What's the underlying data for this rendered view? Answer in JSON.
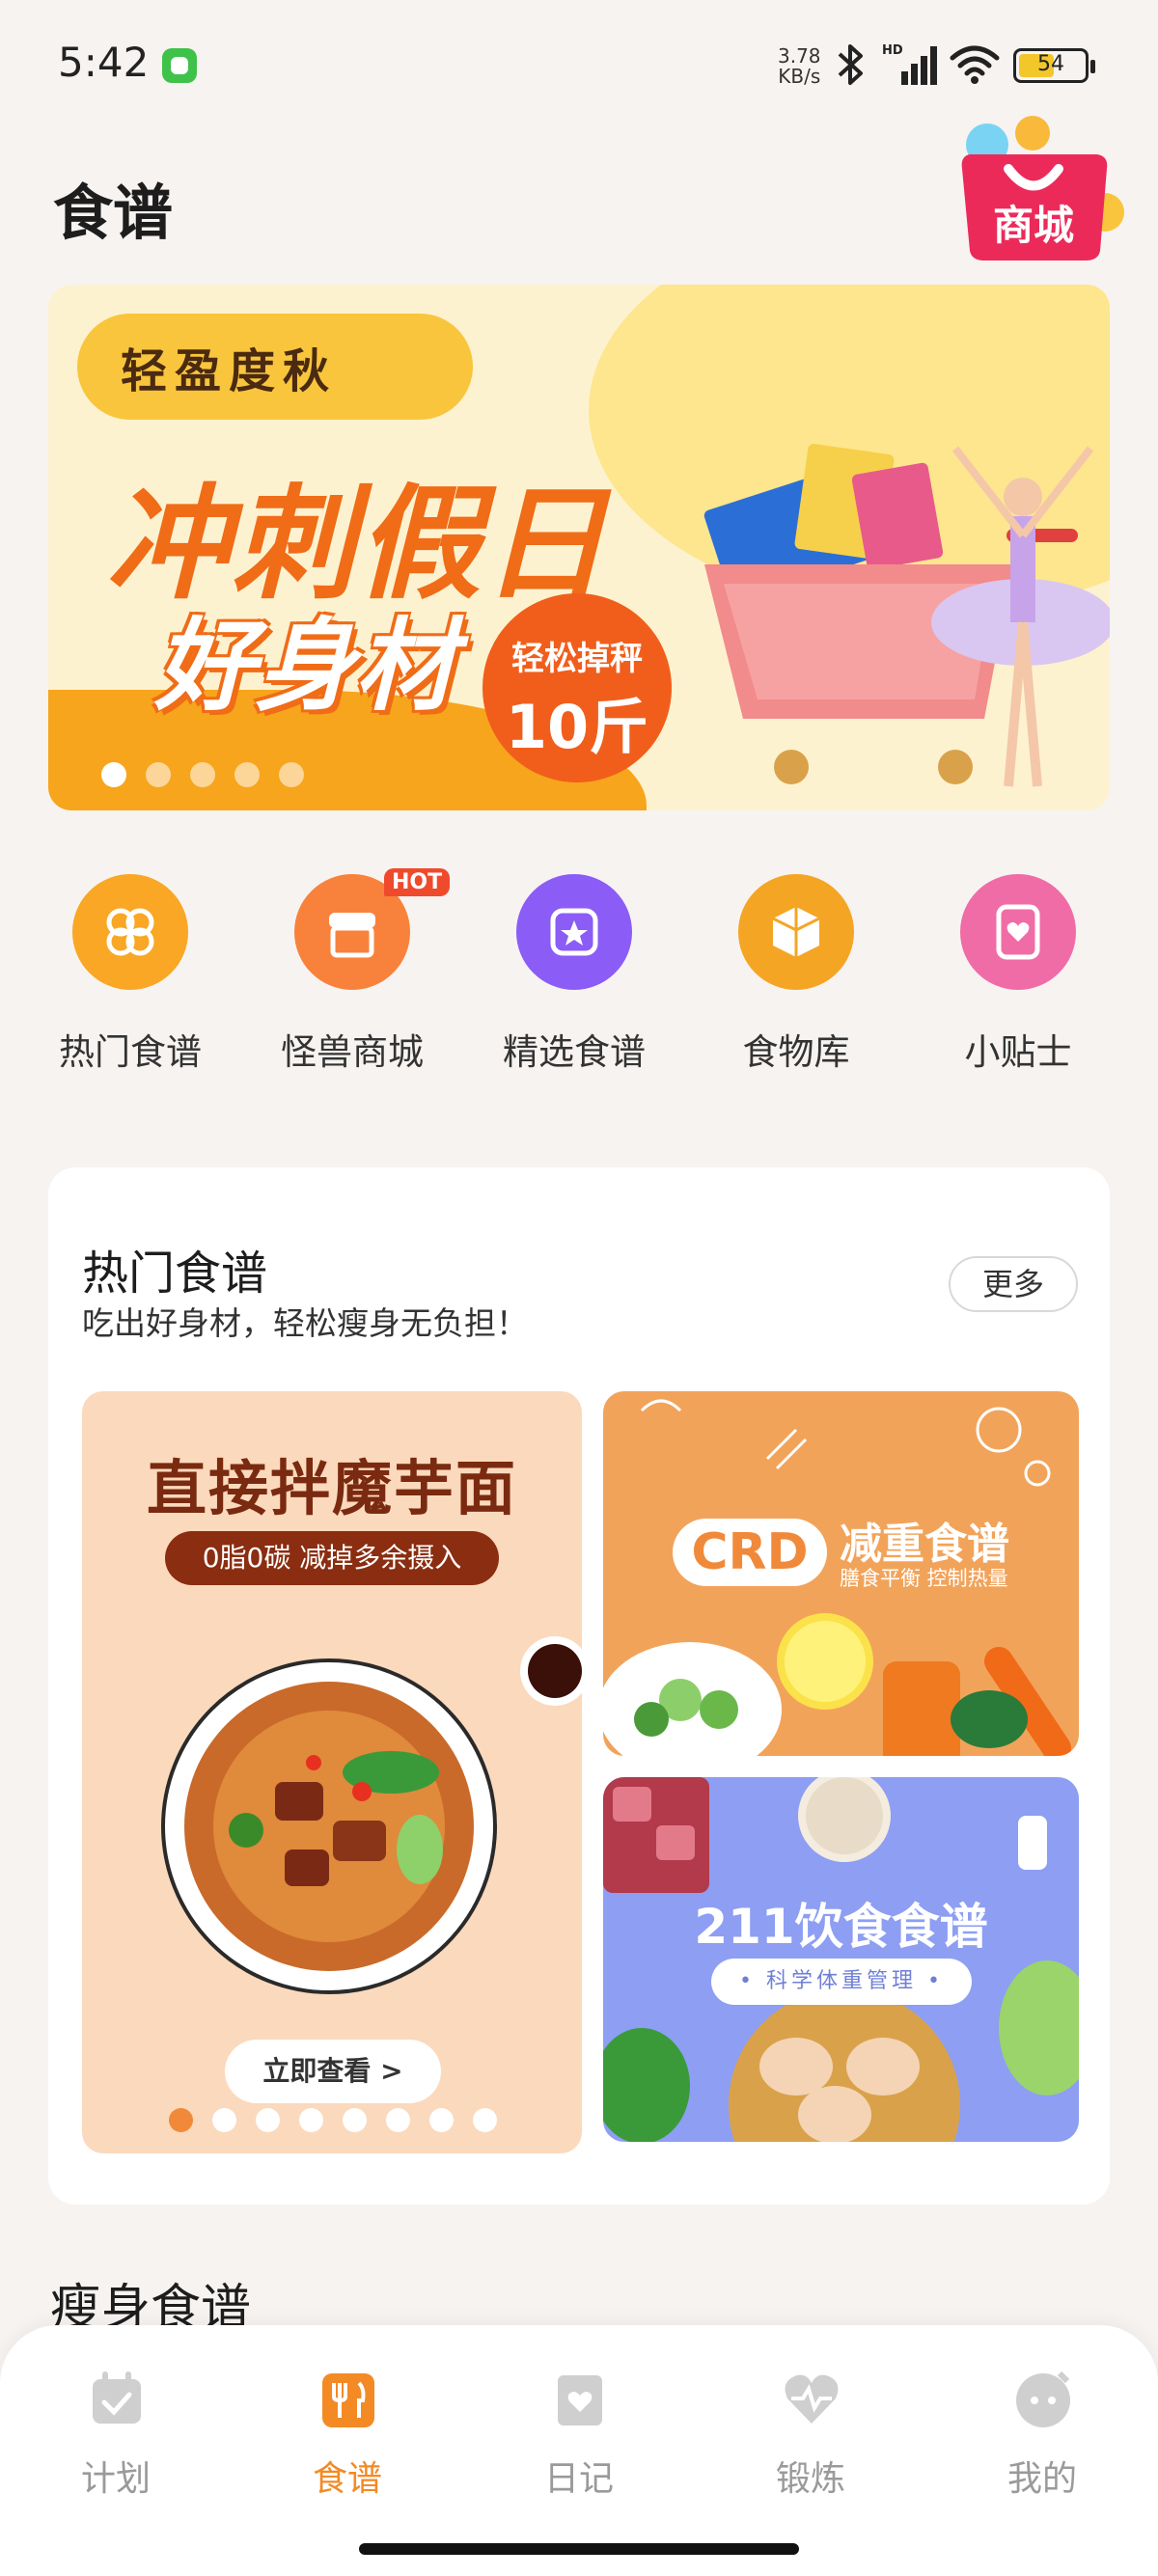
{
  "status_bar": {
    "time": "5:42",
    "net_speed_value": "3.78",
    "net_speed_unit": "KB/s",
    "battery": "54",
    "battery_level": 0.54,
    "icons": [
      "messages-app-icon",
      "bluetooth-icon",
      "hd-signal-icon",
      "wifi-icon",
      "battery-icon"
    ]
  },
  "header": {
    "title": "食谱",
    "mall_badge": "商城"
  },
  "banner": {
    "tag": "轻盈度秋",
    "headline": "冲刺假日",
    "subline": "好身材",
    "seal_line1": "轻松掉秤",
    "seal_line2": "10斤",
    "slide_count": 5,
    "active_slide": 0
  },
  "quick_nav": [
    {
      "label": "热门食谱",
      "icon": "clover-icon",
      "color": "#f9a724"
    },
    {
      "label": "怪兽商城",
      "icon": "store-icon",
      "color": "#f8823c",
      "badge": "HOT"
    },
    {
      "label": "精选食谱",
      "icon": "star-card-icon",
      "color": "#8b5cf6"
    },
    {
      "label": "食物库",
      "icon": "cube-icon",
      "color": "#f5a524"
    },
    {
      "label": "小贴士",
      "icon": "heart-notebook-icon",
      "color": "#f06ca6"
    }
  ],
  "hot_recipes": {
    "title": "热门食谱",
    "subtitle": "吃出好身材，轻松瘦身无负担！",
    "more_label": "更多",
    "promo_main": {
      "title": "直接拌魔芋面",
      "pill": "0脂0碳 减掉多余摄入",
      "cta": "立即查看 >",
      "slide_count": 8,
      "active_slide": 0
    },
    "promo_crd": {
      "logo": "CRD",
      "title": "减重食谱",
      "sub": "膳食平衡 控制热量"
    },
    "promo_211": {
      "title": "211饮食食谱",
      "pill": "• 科学体重管理 •"
    }
  },
  "section_title": "瘦身食谱",
  "bottom_nav": [
    {
      "label": "计划",
      "icon": "calendar-check-icon",
      "active": false
    },
    {
      "label": "食谱",
      "icon": "utensils-icon",
      "active": true
    },
    {
      "label": "日记",
      "icon": "heart-diary-icon",
      "active": false
    },
    {
      "label": "锻炼",
      "icon": "heartbeat-icon",
      "active": false
    },
    {
      "label": "我的",
      "icon": "monster-face-icon",
      "active": false
    }
  ],
  "colors": {
    "accent": "#f38a24",
    "background": "#f7f3f1",
    "inactive_tab": "#9a9a9a"
  }
}
